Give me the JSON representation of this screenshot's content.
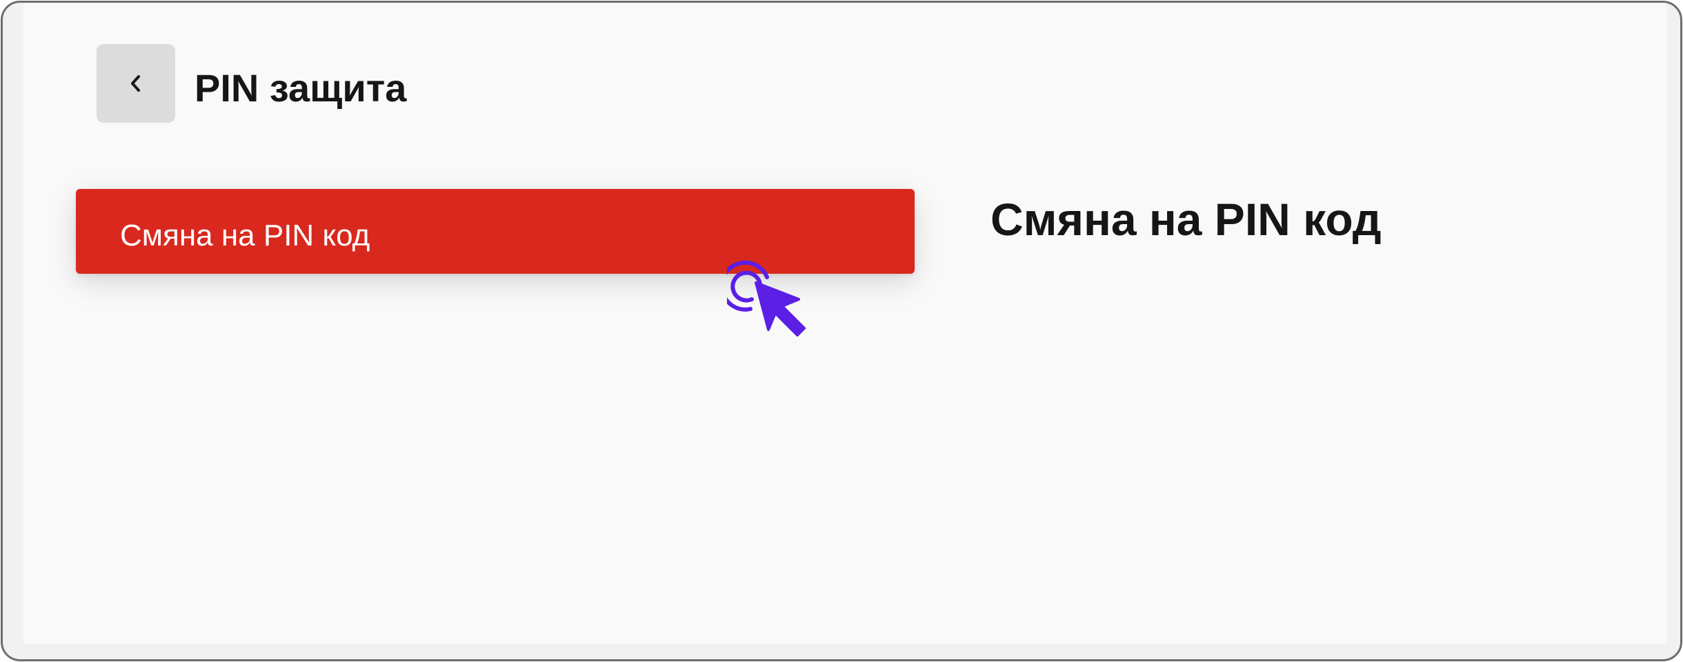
{
  "header": {
    "back_icon": "chevron-left-icon",
    "title": "PIN защита"
  },
  "menu": {
    "items": [
      {
        "label": "Смяна на PIN код",
        "selected": true
      }
    ]
  },
  "content": {
    "section_title": "Смяна на PIN код"
  },
  "cursor": {
    "icon": "click-cursor-icon",
    "color": "#5b1fe6"
  },
  "colors": {
    "accent": "#d9281e",
    "background": "#f9f9f9",
    "back_button_bg": "#dcdcdc",
    "text": "#161616"
  }
}
